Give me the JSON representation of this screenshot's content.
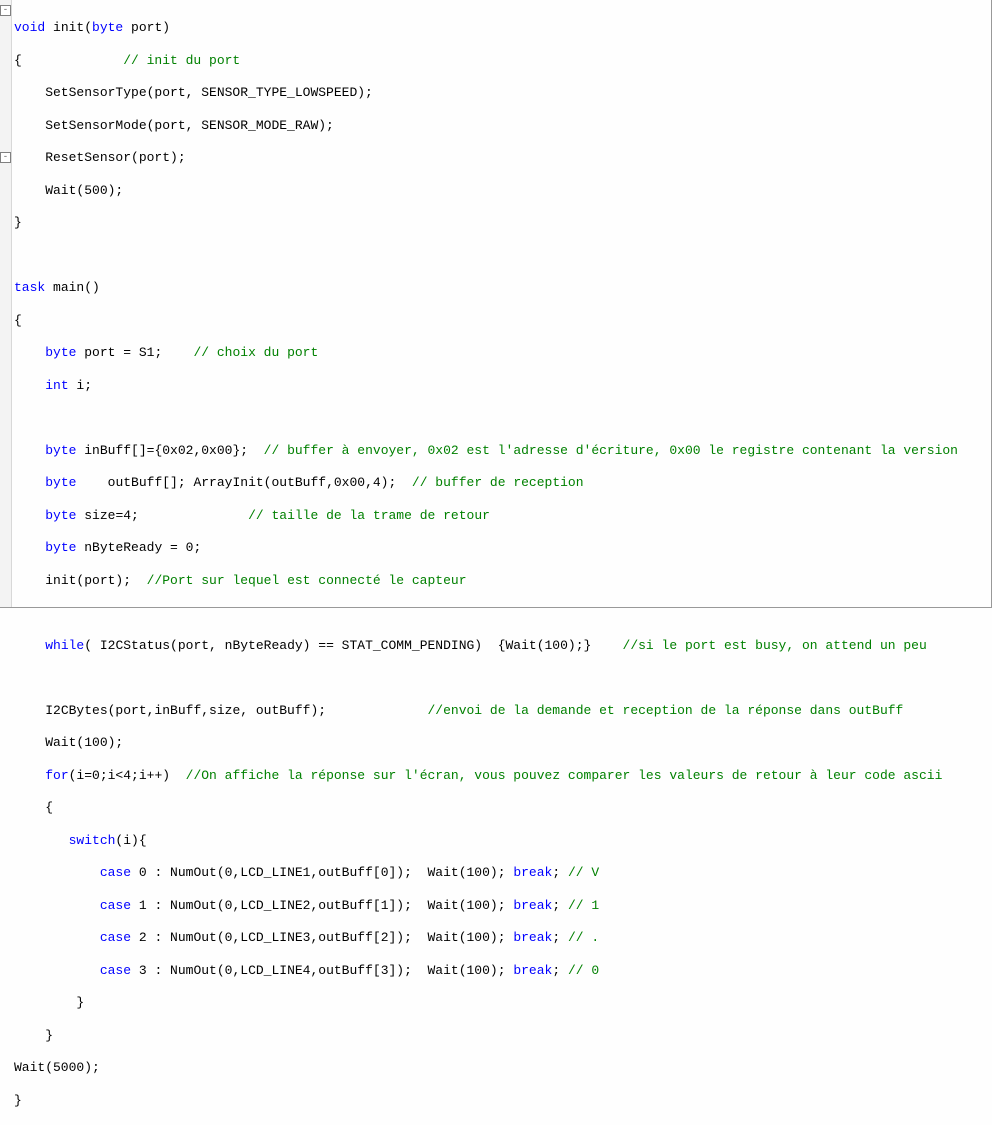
{
  "function_header": {
    "kw_void": "void",
    "name": " init(",
    "kw_byte": "byte",
    "rest": " port)"
  },
  "init_body": {
    "open": "{             ",
    "cm_init": "// init du port",
    "l1": "    SetSensorType(port, SENSOR_TYPE_LOWSPEED);",
    "l2": "    SetSensorMode(port, SENSOR_MODE_RAW);",
    "l3": "    ResetSensor(port);",
    "l4": "    Wait(500);",
    "close": "}"
  },
  "main_header": {
    "kw_task": "task",
    "rest": " main()"
  },
  "main_body": {
    "open": "{",
    "port_decl": {
      "kw": "byte",
      "code": " port = S1;    ",
      "cm": "// choix du port"
    },
    "i_decl": {
      "kw": "int",
      "code": " i;"
    },
    "inbuff": {
      "kw": "byte",
      "code": " inBuff[]={0x02,0x00};  ",
      "cm": "// buffer à envoyer, 0x02 est l'adresse d'écriture, 0x00 le registre contenant la version"
    },
    "outbuff": {
      "kw": "byte",
      "code": "    outBuff[]; ArrayInit(outBuff,0x00,4);  ",
      "cm": "// buffer de reception"
    },
    "size": {
      "kw": "byte",
      "code": " size=4;              ",
      "cm": "// taille de la trame de retour"
    },
    "nbyte": {
      "kw": "byte",
      "code": " nByteReady = 0;"
    },
    "initcall": {
      "code": "init(port);  ",
      "cm": "//Port sur lequel est connecté le capteur"
    },
    "while_line": {
      "kw": "while",
      "code": "( I2CStatus(port, nByteReady) == STAT_COMM_PENDING)  {Wait(100);}    ",
      "cm": "//si le port est busy, on attend un peu"
    },
    "i2cbytes": {
      "code": "I2CBytes(port,inBuff,size, outBuff);             ",
      "cm": "//envoi de la demande et reception de la réponse dans outBuff"
    },
    "wait100": "    Wait(100);",
    "for_line": {
      "kw": "for",
      "code": "(i=0;i<4;i++)  ",
      "cm": "//On affiche la réponse sur l'écran, vous pouvez comparer les valeurs de retour à leur code ascii"
    },
    "for_open": "    {",
    "switch_line": {
      "kw": "switch",
      "code": "(i){"
    },
    "case0": {
      "kw1": "case",
      "mid": " 0 : NumOut(0,LCD_LINE1,outBuff[0]);  Wait(100); ",
      "kw2": "break",
      "end": "; ",
      "cm": "// V"
    },
    "case1": {
      "kw1": "case",
      "mid": " 1 : NumOut(0,LCD_LINE2,outBuff[1]);  Wait(100); ",
      "kw2": "break",
      "end": "; ",
      "cm": "// 1"
    },
    "case2": {
      "kw1": "case",
      "mid": " 2 : NumOut(0,LCD_LINE3,outBuff[2]);  Wait(100); ",
      "kw2": "break",
      "end": "; ",
      "cm": "// ."
    },
    "case3": {
      "kw1": "case",
      "mid": " 3 : NumOut(0,LCD_LINE4,outBuff[3]);  Wait(100); ",
      "kw2": "break",
      "end": "; ",
      "cm": "// 0"
    },
    "switch_close": "        }",
    "for_close": "    }",
    "wait5000": "Wait(5000);",
    "close": "}"
  }
}
